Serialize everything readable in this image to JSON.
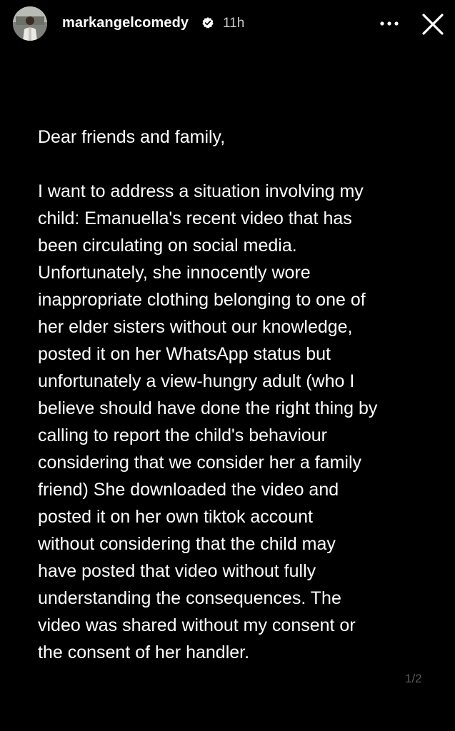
{
  "header": {
    "username": "markangelcomedy",
    "time": "11h",
    "icons": {
      "avatar": "profile-photo",
      "verified": "verified-badge-icon",
      "more": "more-options-icon",
      "close": "close-icon"
    }
  },
  "post": {
    "greeting": "Dear friends and family,",
    "lines": [
      "I want to address a situation involving my",
      "child: Emanuella's recent video that has",
      "been circulating on social media.",
      "Unfortunately, she innocently wore",
      "inappropriate clothing belonging to one of",
      "her elder sisters without our knowledge,",
      "posted it on her WhatsApp status but",
      "unfortunately a view-hungry adult (who I",
      "believe should have done the right thing by",
      "calling to report the child's behaviour",
      "considering that we consider her a  family",
      "friend) She downloaded the video and",
      "posted it on her own tiktok account",
      "without considering that the child may",
      "have posted that video without fully",
      "understanding the consequences. The",
      "video was shared without my consent or",
      "the consent of her handler."
    ]
  },
  "pagination": "1/2",
  "colors": {
    "background": "#000000",
    "text": "#ffffff",
    "muted": "#c8c8c8",
    "page_indicator": "#5a5a5a"
  }
}
